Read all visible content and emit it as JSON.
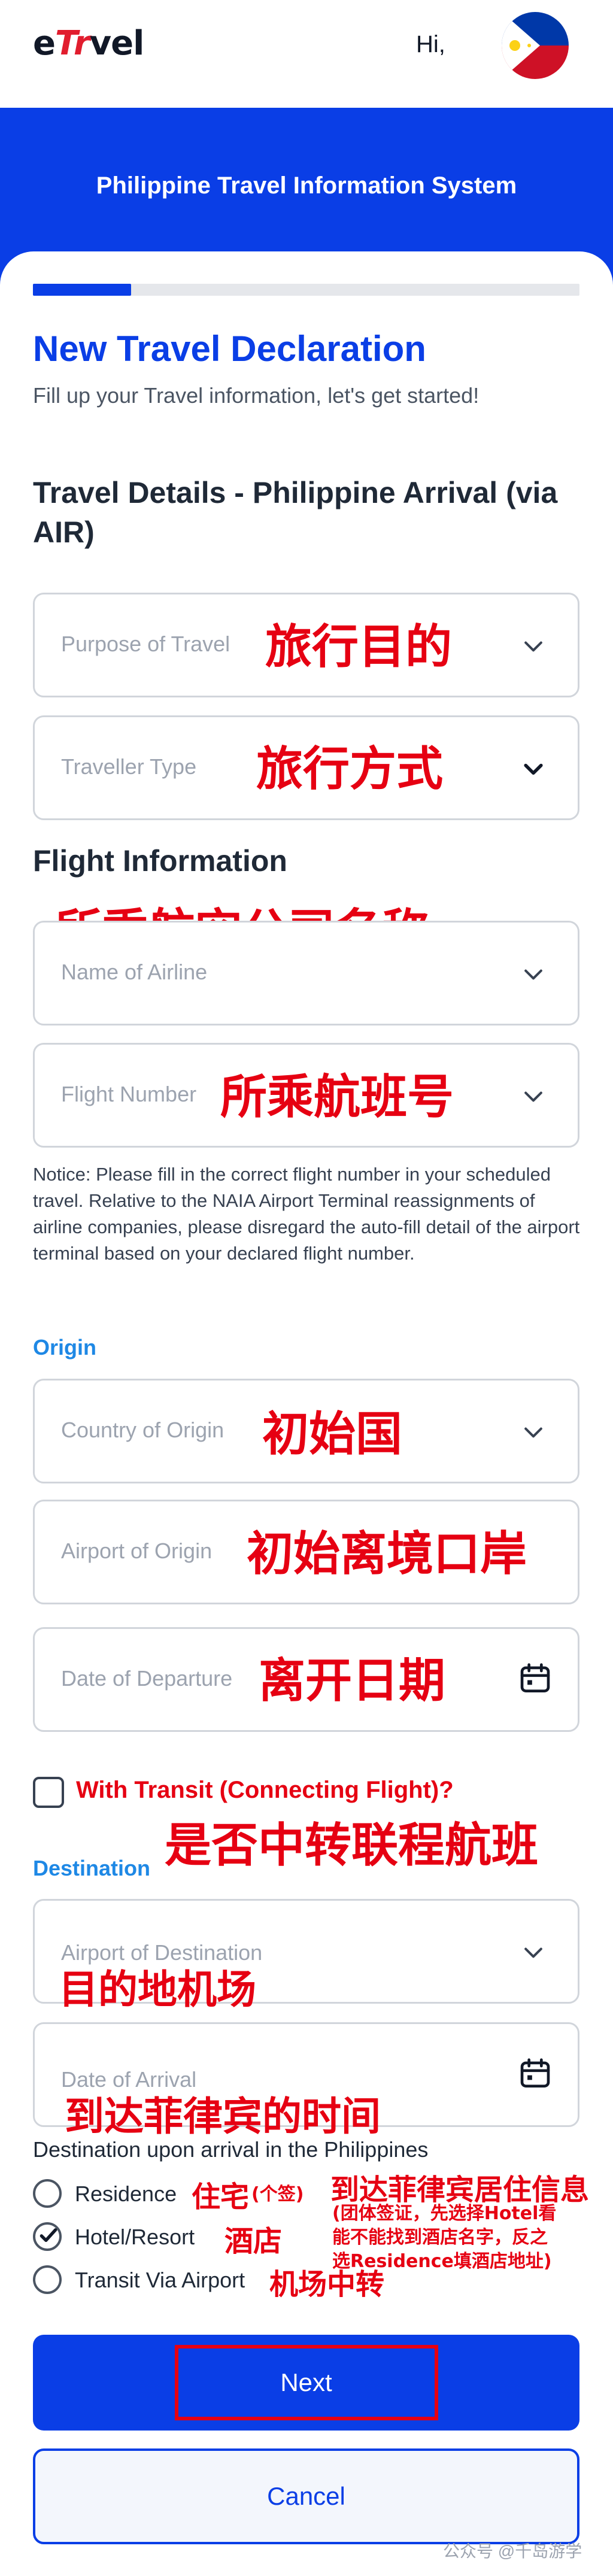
{
  "header": {
    "logo_prefix": "e",
    "logo_accent": "Tr",
    "logo_suffix": "vel",
    "greeting": "Hi,",
    "avatar_icon": "philippine-flag-icon"
  },
  "banner": {
    "title": "Philippine Travel Information System"
  },
  "progress": {
    "fraction": 0.18
  },
  "form": {
    "title": "New Travel Declaration",
    "subtitle": "Fill up your Travel information, let's get started!",
    "section_title": "Travel Details - Philippine Arrival (via AIR)",
    "purpose_placeholder": "Purpose of Travel",
    "traveller_placeholder": "Traveller Type",
    "flight_section": "Flight Information",
    "airline_placeholder": "Name of Airline",
    "flight_number_placeholder": "Flight Number",
    "notice": "Notice: Please fill in the correct flight number in your scheduled travel. Relative to the NAIA Airport Terminal reassignments of airline companies, please disregard the auto-fill detail of the airport terminal based on your declared flight number.",
    "origin_label": "Origin",
    "country_origin_placeholder": "Country of Origin",
    "airport_origin_placeholder": "Airport of Origin",
    "date_departure_placeholder": "Date of Departure",
    "transit_label": "With Transit (Connecting Flight)?",
    "destination_label": "Destination",
    "airport_destination_placeholder": "Airport of Destination",
    "date_arrival_placeholder": "Date of Arrival",
    "destination_question": "Destination upon arrival in the Philippines",
    "options": [
      {
        "label": "Residence",
        "selected": false
      },
      {
        "label": "Hotel/Resort",
        "selected": true
      },
      {
        "label": "Transit Via Airport",
        "selected": false
      }
    ],
    "next_label": "Next",
    "cancel_label": "Cancel"
  },
  "annotations": {
    "purpose": "旅行目的",
    "traveller": "旅行方式",
    "airline": "所乘航空公司名称",
    "flight_number": "所乘航班号",
    "country_origin": "初始国",
    "airport_origin": "初始离境口岸",
    "date_departure": "离开日期",
    "transit": "是否中转联程航班",
    "airport_destination": "目的地机场",
    "date_arrival": "到达菲律宾的时间",
    "residence": "住宅",
    "residence_note": "(个签)",
    "hotel": "酒店",
    "transit_airport": "机场中转",
    "accommodation_title": "到达菲律宾居住信息",
    "accommodation_note_1": "(团体签证，先选择Hotel看",
    "accommodation_note_2": "能不能找到酒店名字，反之",
    "accommodation_note_3": "选Residence填酒店地址)"
  },
  "watermark": {
    "text": "公众号 @千岛游学"
  },
  "colors": {
    "brand_blue": "#0a3ee6",
    "annotation_red": "#e60012",
    "origin_blue": "#1e88e5"
  }
}
